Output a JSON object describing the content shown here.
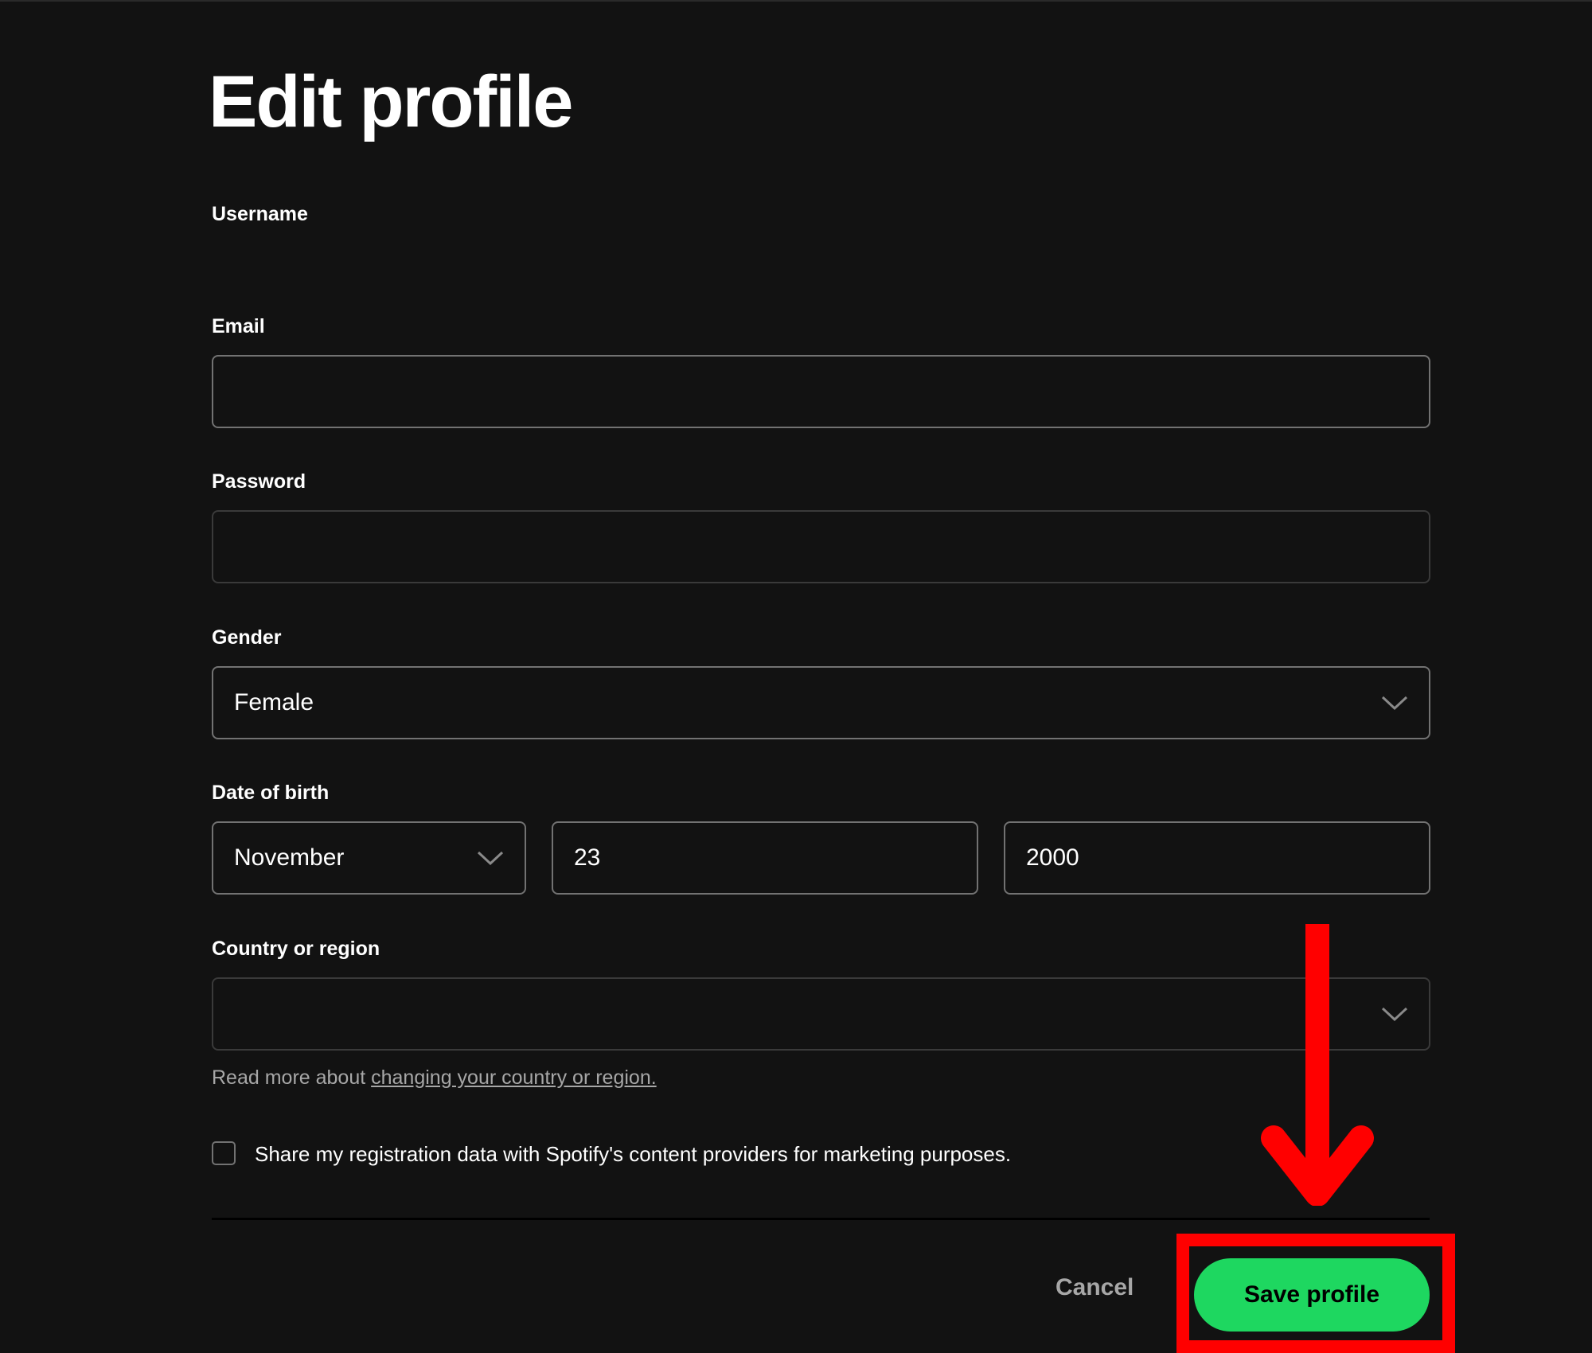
{
  "page": {
    "title": "Edit profile"
  },
  "form": {
    "username": {
      "label": "Username",
      "value": ""
    },
    "email": {
      "label": "Email",
      "value": "",
      "placeholder": ""
    },
    "password": {
      "label": "Password",
      "value": "",
      "placeholder": ""
    },
    "gender": {
      "label": "Gender",
      "value": "Female",
      "icon": "chevron-down-icon"
    },
    "date_of_birth": {
      "label": "Date of birth",
      "month": "November",
      "day": "23",
      "year": "2000"
    },
    "country": {
      "label": "Country or region",
      "value": "",
      "icon": "chevron-down-icon"
    },
    "help_text": "Read more about ",
    "help_link": "changing your country or region.",
    "marketing_checkbox": {
      "label": "Share my registration data with Spotify's content providers for marketing purposes.",
      "checked": false
    }
  },
  "actions": {
    "cancel_label": "Cancel",
    "save_label": "Save profile"
  },
  "annotation": {
    "arrow": "red-down-arrow",
    "highlight_color": "#ff0000"
  },
  "colors": {
    "background": "#121212",
    "accent": "#1ed760",
    "muted_text": "#a7a7a7"
  }
}
